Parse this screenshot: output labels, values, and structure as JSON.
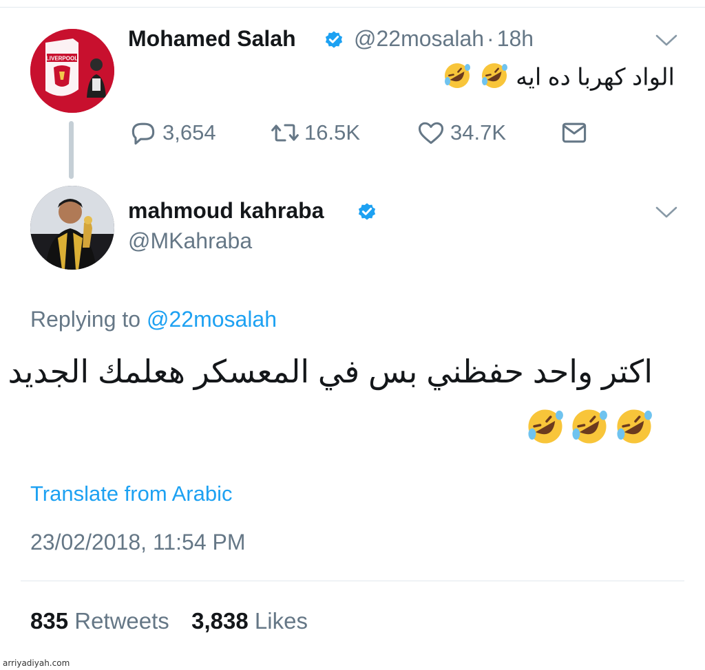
{
  "parent_tweet": {
    "author_name": "Mohamed Salah",
    "handle": "@22mosalah",
    "separator": "·",
    "time_ago": "18h",
    "text": "الواد كهربا ده ايه",
    "emoji_count": 2,
    "avatar_logo_text": "LIVERPOOL",
    "actions": {
      "replies": "3,654",
      "retweets": "16.5K",
      "likes": "34.7K"
    }
  },
  "reply_tweet": {
    "author_name": "mahmoud kahraba",
    "handle": "@MKahraba",
    "replying_label": "Replying to",
    "replying_to": "@22mosalah",
    "text": "اكتر واحد حفظني بس في المعسكر هعلمك الجديد",
    "emoji_count": 3,
    "translate_label": "Translate from Arabic",
    "timestamp": "23/02/2018, 11:54 PM",
    "stats": {
      "retweets_count": "835",
      "retweets_label": "Retweets",
      "likes_count": "3,838",
      "likes_label": "Likes"
    }
  },
  "watermark": "arriyadiyah.com",
  "colors": {
    "link": "#1da1f2",
    "muted": "#657786",
    "text": "#14171a",
    "divider": "#e1e8ed"
  },
  "icons": {
    "reply": "reply-icon",
    "retweet": "retweet-icon",
    "like": "heart-icon",
    "dm": "envelope-icon",
    "verified": "verified-badge-icon",
    "menu": "chevron-down-icon",
    "emoji": "rolling-on-floor-laughing-emoji"
  }
}
